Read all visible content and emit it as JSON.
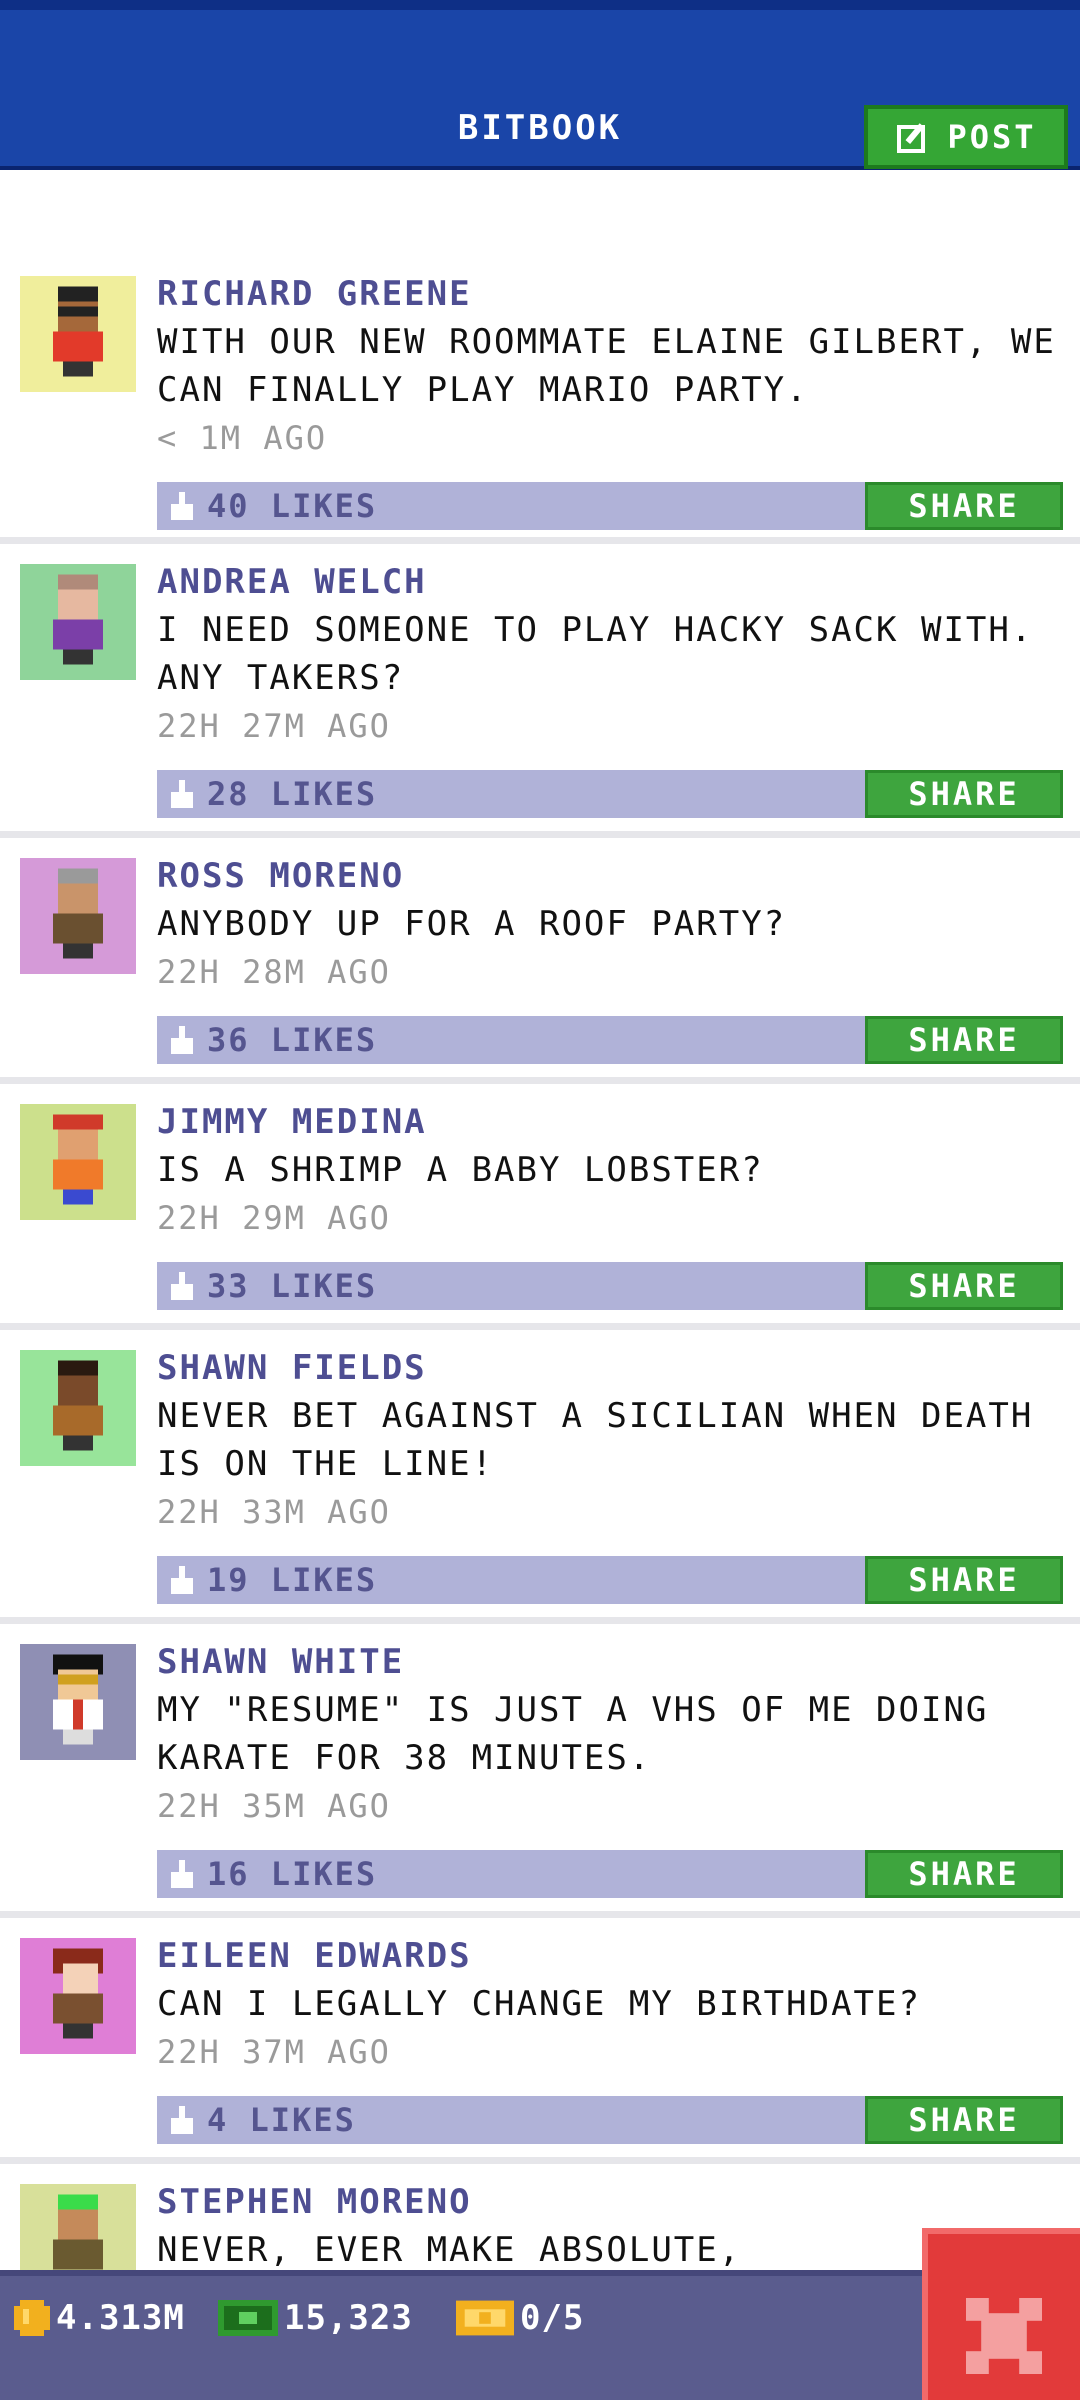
{
  "header": {
    "title": "BITBOOK",
    "post_label": "POST"
  },
  "posts": [
    {
      "name": "RICHARD GREENE",
      "text": "WITH OUR NEW ROOMMATE ELAINE GILBERT, WE CAN FINALLY PLAY MARIO PARTY.",
      "time": "< 1M AGO",
      "likes": "40 LIKES",
      "share": "SHARE",
      "avatar_bg": "#f0ee9c",
      "skin": "#a5683a",
      "shirt": "#e23a2a",
      "hair": "#222222"
    },
    {
      "name": "ANDREA WELCH",
      "text": "I NEED SOMEONE TO PLAY HACKY SACK WITH. ANY TAKERS?",
      "time": "22H 27M AGO",
      "likes": "28 LIKES",
      "share": "SHARE",
      "avatar_bg": "#8fd49a",
      "skin": "#e6b8a0",
      "shirt": "#7b3fa8",
      "hair": "#b08a7a"
    },
    {
      "name": "ROSS MORENO",
      "text": "ANYBODY UP FOR A ROOF PARTY?",
      "time": "22H 28M AGO",
      "likes": "36 LIKES",
      "share": "SHARE",
      "avatar_bg": "#d59ad8",
      "skin": "#c9946a",
      "shirt": "#6a5030",
      "hair": "#9a9a9a"
    },
    {
      "name": "JIMMY MEDINA",
      "text": "IS A SHRIMP A BABY LOBSTER?",
      "time": "22H 29M AGO",
      "likes": "33 LIKES",
      "share": "SHARE",
      "avatar_bg": "#cce08c",
      "skin": "#e0a070",
      "shirt": "#f07a2a",
      "hair": "#d03a2a"
    },
    {
      "name": "SHAWN FIELDS",
      "text": "NEVER BET AGAINST A SICILIAN WHEN DEATH IS ON THE LINE!",
      "time": "22H 33M AGO",
      "likes": "19 LIKES",
      "share": "SHARE",
      "avatar_bg": "#98e49a",
      "skin": "#7a4a2a",
      "shirt": "#a86a2a",
      "hair": "#2a1a10"
    },
    {
      "name": "SHAWN WHITE",
      "text": "MY \"RESUME\" IS JUST A VHS OF ME DOING KARATE FOR 38 MINUTES.",
      "time": "22H 35M AGO",
      "likes": "16 LIKES",
      "share": "SHARE",
      "avatar_bg": "#8f8fb4",
      "skin": "#f0c896",
      "shirt": "#ffffff",
      "hair": "#111111"
    },
    {
      "name": "EILEEN EDWARDS",
      "text": "CAN I LEGALLY CHANGE MY BIRTHDATE?",
      "time": "22H 37M AGO",
      "likes": "4 LIKES",
      "share": "SHARE",
      "avatar_bg": "#df7ed6",
      "skin": "#f4d2b8",
      "shirt": "#7a5030",
      "hair": "#8a2a1a"
    },
    {
      "name": "STEPHEN MORENO",
      "text": "NEVER, EVER MAKE ABSOLUTE,",
      "time": "",
      "likes": "",
      "share": "",
      "avatar_bg": "#d8e09a",
      "skin": "#c58a5a",
      "shirt": "#6a5a30",
      "hair": "#3adc4a"
    }
  ],
  "bottom_bar": {
    "coins": "4.313M",
    "bux": "15,323",
    "tickets": "0/5"
  },
  "colors": {
    "header": "#1a45a8",
    "share_green": "#3ea53e",
    "likes_bar": "#b0b2d8",
    "name_purple": "#4e4e92",
    "close_red": "#e23a3a"
  }
}
